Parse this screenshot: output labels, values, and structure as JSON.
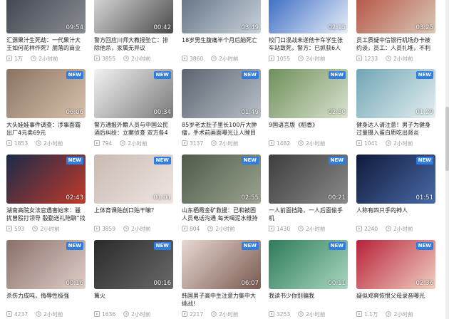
{
  "accent_color": "#2f7de1",
  "new_badge_label": "NEW",
  "play_count_icon": "play-square-icon",
  "time_icon": "clock-icon",
  "videos": [
    {
      "title": "汇源果汁生死劫：一代果汁大王如何花样作死？朋落的商业巨头",
      "duration": "09:54",
      "plays": "1万",
      "time": "2小时前",
      "is_new": false,
      "colors": [
        "#3a3f4a",
        "#8a8d93"
      ]
    },
    {
      "title": "警方回应川师大教授坠亡：排除他杀，家属无异议",
      "duration": "00:42",
      "plays": "3855",
      "time": "2小时前",
      "is_new": false,
      "colors": [
        "#e7e7e7",
        "#4a4a4a"
      ]
    },
    {
      "title": "18岁男生腹痛半个月后脑死亡",
      "duration": "03:49",
      "plays": "3860",
      "time": "2小时前",
      "is_new": false,
      "colors": [
        "#5a6b7c",
        "#c9d2dc"
      ]
    },
    {
      "title": "校门口混战未遂他卡车学生张车站致死，警方：已抓获6人",
      "duration": "02:15",
      "plays": "1055",
      "time": "2小时前",
      "is_new": false,
      "colors": [
        "#2a5fbf",
        "#e8eef8"
      ]
    },
    {
      "title": "员工质疑中信银行机场办卡被约谈，员工：人员扎堆，不利于防疫",
      "duration": "03:25",
      "plays": "1233",
      "time": "2小时前",
      "is_new": false,
      "colors": [
        "#b34a3a",
        "#d8c8b8"
      ]
    },
    {
      "title": "大头娃娃事件调查：涉事面霜出厂4元卖69元",
      "duration": "06:06",
      "plays": "1853",
      "time": "2小时前",
      "is_new": true,
      "colors": [
        "#8a7260",
        "#d9c3ae"
      ]
    },
    {
      "title": "警方通报外籍人员与中国公民酒后纠纷：立案侦查 双方各4人被拘押",
      "duration": "00:34",
      "plays": "794",
      "time": "2小时前",
      "is_new": true,
      "colors": [
        "#f2f2f2",
        "#7a7a7a"
      ]
    },
    {
      "title": "85岁老太肚子里长100斤大肿瘤，手术前画面曝光让人瞠目结舌",
      "duration": "01:49",
      "plays": "3137",
      "time": "2小时前",
      "is_new": true,
      "colors": [
        "#5b6470",
        "#b9c0c8"
      ]
    },
    {
      "title": "9国语言版《稻香》",
      "duration": "02:50",
      "plays": "1482",
      "time": "2小时前",
      "is_new": true,
      "colors": [
        "#6f8f5a",
        "#d9e3cf"
      ]
    },
    {
      "title": "健身达人请注意！男子为健身过量摄入蛋白质吃出肾炎",
      "duration": "01:29",
      "plays": "1041",
      "time": "2小时前",
      "is_new": true,
      "colors": [
        "#6fa6b5",
        "#e6eef0"
      ]
    },
    {
      "title": "湖南高院女法官遇害始末：骚扰曾殴打领导 殷勤送礼陪聊“找关系”",
      "duration": "02:43",
      "plays": "593",
      "time": "2小时前",
      "is_new": true,
      "colors": [
        "#1a2a4a",
        "#c23a2a"
      ]
    },
    {
      "title": "上体育课贴创口贴干嘛？",
      "duration": "01:01",
      "plays": "3859",
      "time": "2小时前",
      "is_new": true,
      "colors": [
        "#c9b9b2",
        "#efe6e2"
      ]
    },
    {
      "title": "山东栖霞金矿救援：已和被困人员电话沟通 每天喝泥水维持生存",
      "duration": "02:55",
      "plays": "804",
      "time": "2小时前",
      "is_new": true,
      "colors": [
        "#4f5a4a",
        "#9aa48f"
      ]
    },
    {
      "title": "一人前面挡路，一人后面偷手机",
      "duration": "00:21",
      "plays": "1430",
      "time": "2小时前",
      "is_new": true,
      "colors": [
        "#3d3d3d",
        "#8a8a8a"
      ]
    },
    {
      "title": "人称有四只手的神人",
      "duration": "01:51",
      "plays": "2240",
      "time": "2小时前",
      "is_new": true,
      "colors": [
        "#0f1a3a",
        "#4a6aa8"
      ]
    },
    {
      "title": "杀伤力成吨，侮辱性极强",
      "duration": "00:16",
      "plays": "4237",
      "time": "2小时前",
      "is_new": true,
      "colors": [
        "#8a6f6a",
        "#e0cfc9"
      ]
    },
    {
      "title": "篝火",
      "duration": "00:16",
      "plays": "1636",
      "time": "2小时前",
      "is_new": true,
      "colors": [
        "#2a2a2a",
        "#6a6a6a"
      ]
    },
    {
      "title": "韩国男子高中生注意力集中大挑战!",
      "duration": "06:07",
      "plays": "2217",
      "time": "2小时前",
      "is_new": true,
      "colors": [
        "#e8d8d2",
        "#7a5a50"
      ]
    },
    {
      "title": "我读书少你别骗我",
      "duration": "00:11",
      "plays": "3253",
      "time": "2小时前",
      "is_new": true,
      "colors": [
        "#2f7a5a",
        "#a8d8c0"
      ]
    },
    {
      "title": "疑似郑爽恢恨父母录音曝光",
      "duration": "02:36",
      "plays": "1.1万",
      "time": "2小时前",
      "is_new": true,
      "colors": [
        "#b8203a",
        "#f0d0c0"
      ]
    }
  ]
}
